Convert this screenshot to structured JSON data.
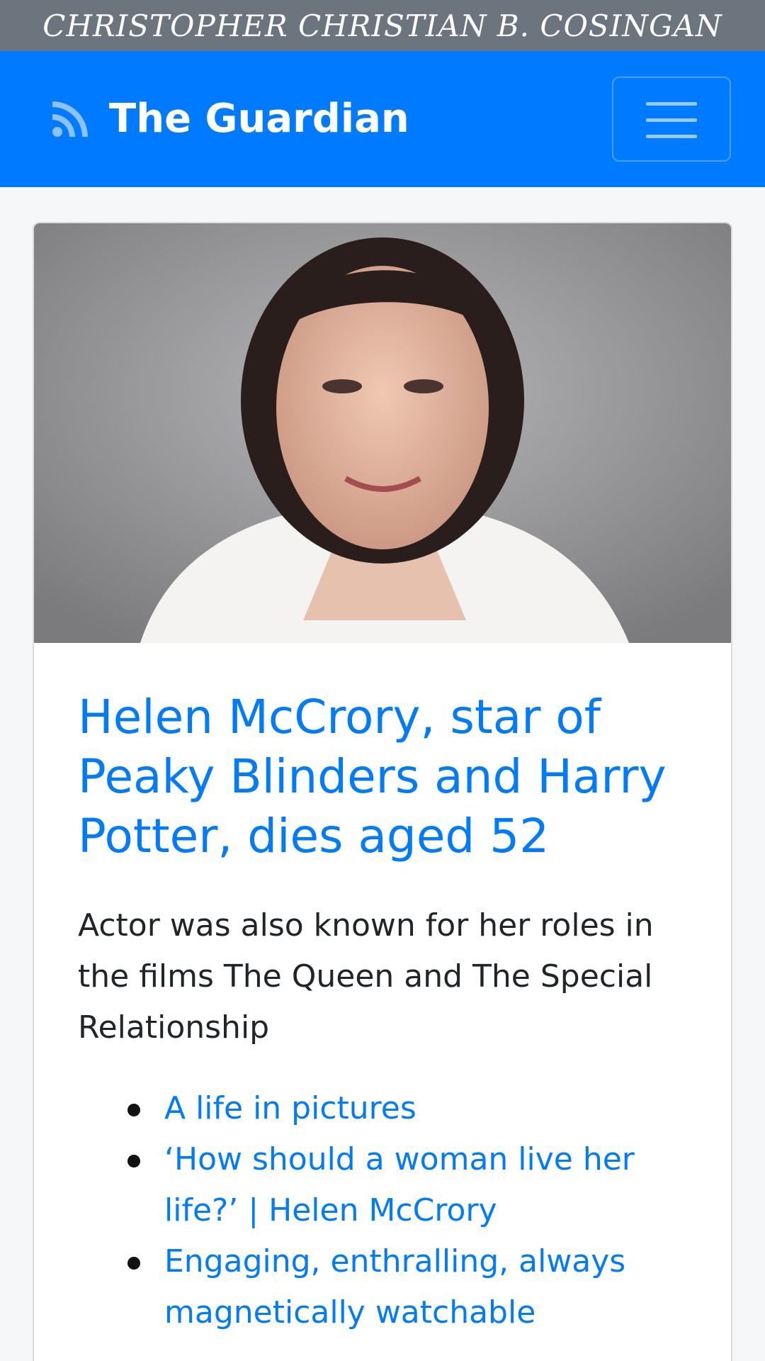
{
  "banner": {
    "text": "CHRISTOPHER CHRISTIAN B. COSINGAN"
  },
  "navbar": {
    "brand_icon": "rss-icon",
    "brand": "The Guardian",
    "toggler_icon": "hamburger-menu-icon",
    "color": "#007bff"
  },
  "article": {
    "image": "portrait-photo",
    "headline": "Helen McCrory, star of Peaky Blinders and Harry Potter, dies aged 52",
    "summary": "Actor was also known for her roles in the films The Queen and The Special Relationship",
    "related": [
      "A life in pictures",
      "‘How should a woman live her life?’ | Helen McCrory",
      "Engaging, enthralling, always magnetically watchable"
    ]
  }
}
